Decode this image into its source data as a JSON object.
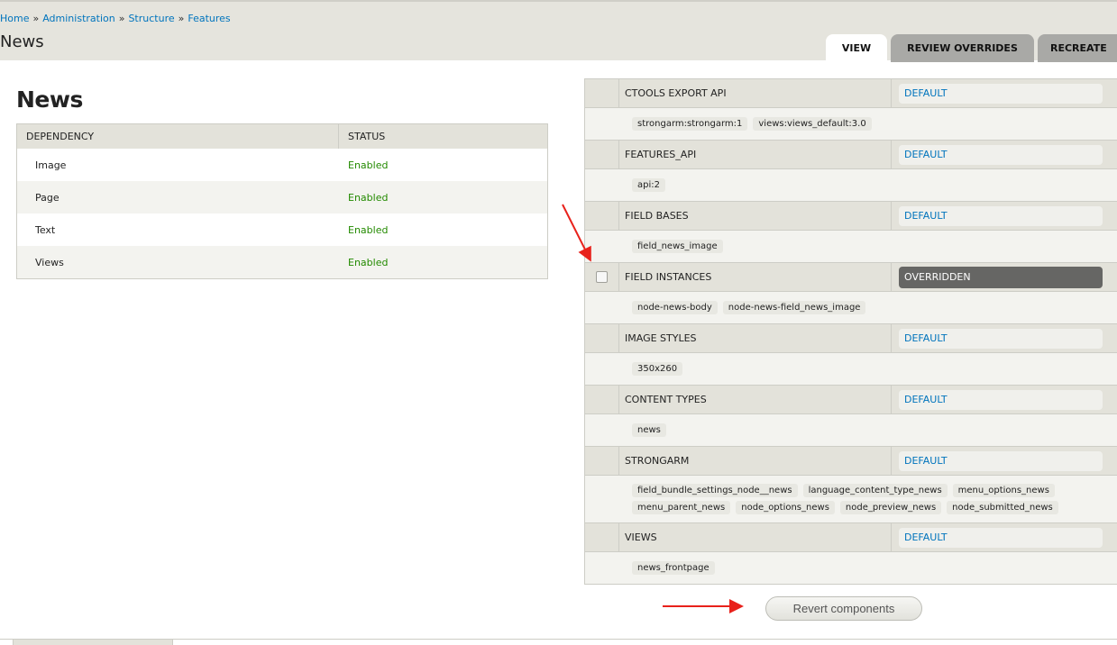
{
  "breadcrumb": {
    "home": "Home",
    "sep": "»",
    "admin": "Administration",
    "structure": "Structure",
    "features": "Features"
  },
  "page_title": "News",
  "tabs": {
    "view": "VIEW",
    "review": "REVIEW OVERRIDES",
    "recreate": "RECREATE"
  },
  "dependencies": {
    "title": "News",
    "headers": {
      "dependency": "DEPENDENCY",
      "status": "STATUS"
    },
    "rows": [
      {
        "name": "Image",
        "status": "Enabled"
      },
      {
        "name": "Page",
        "status": "Enabled"
      },
      {
        "name": "Text",
        "status": "Enabled"
      },
      {
        "name": "Views",
        "status": "Enabled"
      }
    ]
  },
  "components": [
    {
      "name": "CTOOLS EXPORT API",
      "state": "DEFAULT",
      "items": [
        "strongarm:strongarm:1",
        "views:views_default:3.0"
      ]
    },
    {
      "name": "FEATURES_API",
      "state": "DEFAULT",
      "items": [
        "api:2"
      ]
    },
    {
      "name": "FIELD BASES",
      "state": "DEFAULT",
      "items": [
        "field_news_image"
      ]
    },
    {
      "name": "FIELD INSTANCES",
      "state": "OVERRIDDEN",
      "items": [
        "node-news-body",
        "node-news-field_news_image"
      ]
    },
    {
      "name": "IMAGE STYLES",
      "state": "DEFAULT",
      "items": [
        "350x260"
      ]
    },
    {
      "name": "CONTENT TYPES",
      "state": "DEFAULT",
      "items": [
        "news"
      ]
    },
    {
      "name": "STRONGARM",
      "state": "DEFAULT",
      "items": [
        "field_bundle_settings_node__news",
        "language_content_type_news",
        "menu_options_news",
        "menu_parent_news",
        "node_options_news",
        "node_preview_news",
        "node_submitted_news"
      ]
    },
    {
      "name": "VIEWS",
      "state": "DEFAULT",
      "items": [
        "news_frontpage"
      ]
    }
  ],
  "revert_button": "Revert components",
  "colors": {
    "link": "#0074bd",
    "enabled": "#238a00",
    "overridden_bg": "#666664",
    "arrow": "#e8211b"
  }
}
